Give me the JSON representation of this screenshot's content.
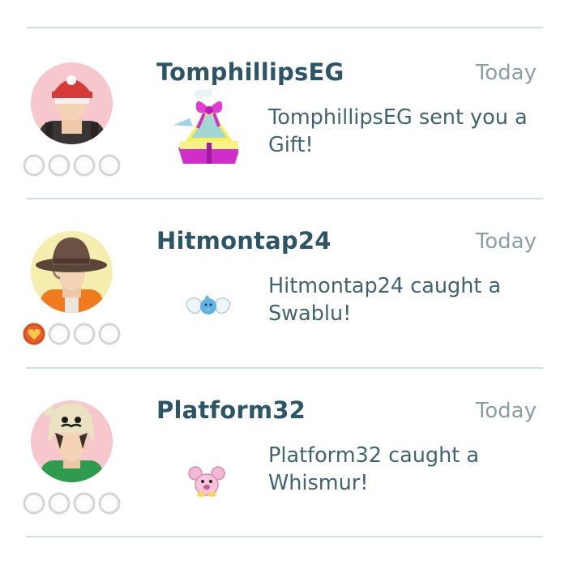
{
  "feed": [
    {
      "name": "TomphillipsEG",
      "time": "Today",
      "message": "TomphillipsEG sent you a Gift!",
      "friendship_level": 0,
      "avatar_bg": "#f6c7cc",
      "icon": "gift-box-icon"
    },
    {
      "name": "Hitmontap24",
      "time": "Today",
      "message": "Hitmontap24 caught a Swablu!",
      "friendship_level": 1,
      "avatar_bg": "#f6eeae",
      "icon": "swablu-icon"
    },
    {
      "name": "Platform32",
      "time": "Today",
      "message": "Platform32 caught a Whismur!",
      "friendship_level": 0,
      "avatar_bg": "#f6c7cc",
      "icon": "whismur-icon"
    }
  ],
  "colors": {
    "name_text": "#2c5566",
    "time_text": "#8a9ea3",
    "message_text": "#3f6470",
    "divider": "#d3dedd",
    "heart_empty": "#d5d5d5",
    "heart_filled": "#e8612c"
  }
}
